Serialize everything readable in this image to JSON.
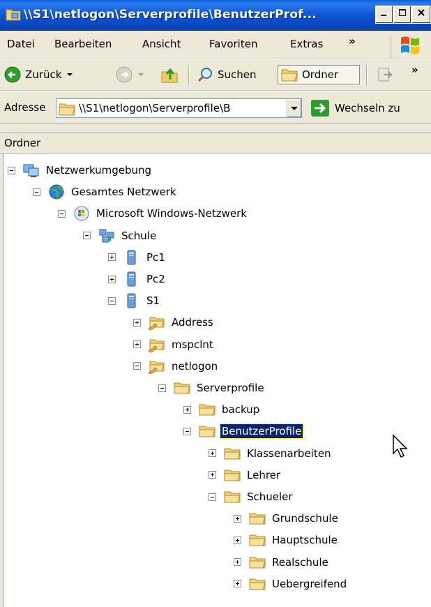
{
  "window": {
    "title": "\\\\S1\\netlogon\\Serverprofile\\BenutzerProf..."
  },
  "menu": {
    "items": [
      "Datei",
      "Bearbeiten",
      "Ansicht",
      "Favoriten",
      "Extras"
    ],
    "more": "»"
  },
  "toolbar": {
    "back_label": "Zurück",
    "search_label": "Suchen",
    "folders_label": "Ordner",
    "more": "»"
  },
  "address": {
    "label": "Adresse",
    "value": "\\\\S1\\netlogon\\Serverprofile\\B",
    "go_label": "Wechseln zu"
  },
  "pane": {
    "header": "Ordner"
  },
  "tree": {
    "nodes": [
      {
        "label": "Netzwerkumgebung",
        "icon": "network-places-icon",
        "expanded": true
      },
      {
        "label": "Gesamtes Netzwerk",
        "icon": "globe-icon",
        "expanded": true
      },
      {
        "label": "Microsoft Windows-Netzwerk",
        "icon": "windows-network-icon",
        "expanded": true
      },
      {
        "label": "Schule",
        "icon": "workgroup-icon",
        "expanded": true
      },
      {
        "label": "Pc1",
        "icon": "computer-icon",
        "expanded": false
      },
      {
        "label": "Pc2",
        "icon": "computer-icon",
        "expanded": false
      },
      {
        "label": "S1",
        "icon": "computer-icon",
        "expanded": true
      },
      {
        "label": "Address",
        "icon": "shared-folder-icon",
        "expanded": false
      },
      {
        "label": "mspclnt",
        "icon": "shared-folder-icon",
        "expanded": false
      },
      {
        "label": "netlogon",
        "icon": "shared-folder-icon",
        "expanded": true
      },
      {
        "label": "Serverprofile",
        "icon": "folder-icon",
        "expanded": true
      },
      {
        "label": "backup",
        "icon": "folder-icon",
        "expanded": false
      },
      {
        "label": "BenutzerProfile",
        "icon": "folder-icon",
        "expanded": true,
        "selected": true
      },
      {
        "label": "Klassenarbeiten",
        "icon": "folder-icon",
        "expanded": false
      },
      {
        "label": "Lehrer",
        "icon": "folder-icon",
        "expanded": false
      },
      {
        "label": "Schueler",
        "icon": "folder-icon",
        "expanded": true
      },
      {
        "label": "Grundschule",
        "icon": "folder-icon",
        "expanded": false
      },
      {
        "label": "Hauptschule",
        "icon": "folder-icon",
        "expanded": false
      },
      {
        "label": "Realschule",
        "icon": "folder-icon",
        "expanded": false
      },
      {
        "label": "Uebergreifend",
        "icon": "folder-icon",
        "expanded": false
      }
    ]
  }
}
